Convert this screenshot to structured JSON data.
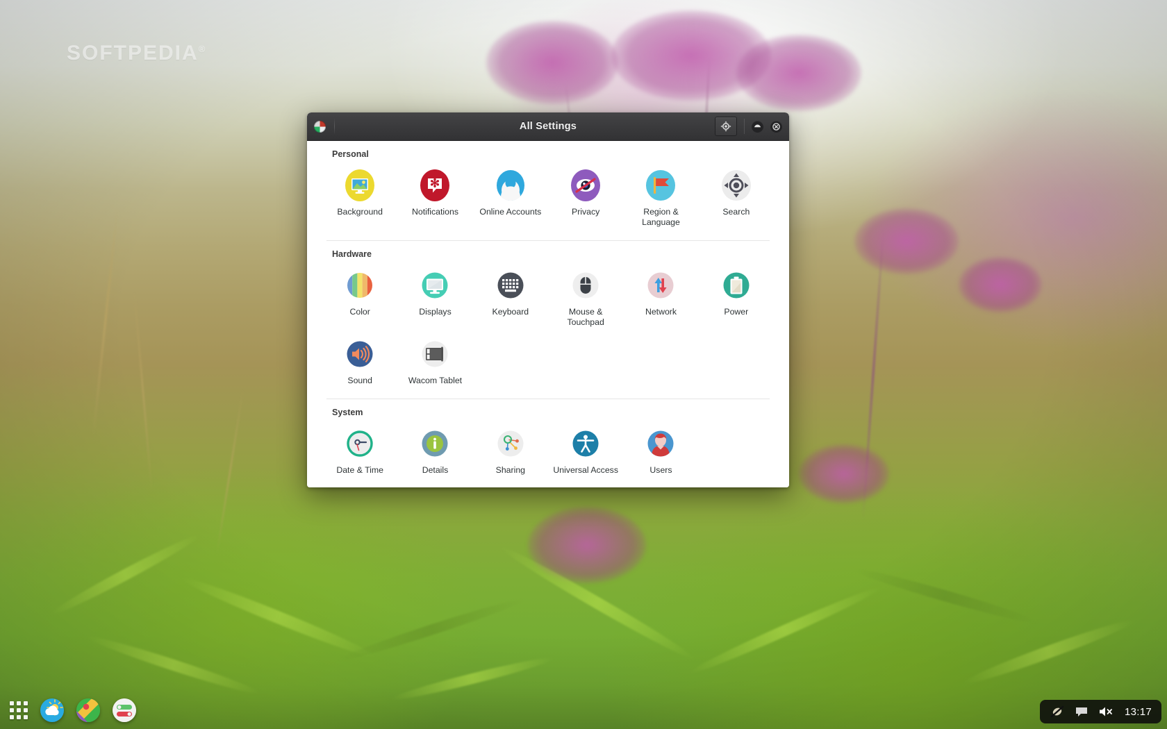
{
  "desktop": {
    "watermark": "SOFTPEDIA",
    "watermark_sup": "®"
  },
  "window": {
    "title": "All Settings",
    "appmenu_icon": "app-menu-icon",
    "search_button": "search-icon",
    "minimize_button": "minimize-icon",
    "close_button": "close-icon"
  },
  "sections": [
    {
      "title": "Personal",
      "items": [
        {
          "label": "Background",
          "icon": "background-icon"
        },
        {
          "label": "Notifications",
          "icon": "notifications-icon"
        },
        {
          "label": "Online Accounts",
          "icon": "online-accounts-icon"
        },
        {
          "label": "Privacy",
          "icon": "privacy-icon"
        },
        {
          "label": "Region & Language",
          "icon": "region-language-icon"
        },
        {
          "label": "Search",
          "icon": "search-settings-icon"
        }
      ]
    },
    {
      "title": "Hardware",
      "items": [
        {
          "label": "Color",
          "icon": "color-icon"
        },
        {
          "label": "Displays",
          "icon": "displays-icon"
        },
        {
          "label": "Keyboard",
          "icon": "keyboard-icon"
        },
        {
          "label": "Mouse & Touchpad",
          "icon": "mouse-touchpad-icon"
        },
        {
          "label": "Network",
          "icon": "network-icon"
        },
        {
          "label": "Power",
          "icon": "power-icon"
        },
        {
          "label": "Sound",
          "icon": "sound-icon"
        },
        {
          "label": "Wacom Tablet",
          "icon": "wacom-tablet-icon"
        }
      ]
    },
    {
      "title": "System",
      "items": [
        {
          "label": "Date & Time",
          "icon": "date-time-icon"
        },
        {
          "label": "Details",
          "icon": "details-icon"
        },
        {
          "label": "Sharing",
          "icon": "sharing-icon"
        },
        {
          "label": "Universal Access",
          "icon": "universal-access-icon"
        },
        {
          "label": "Users",
          "icon": "users-icon"
        }
      ]
    }
  ],
  "taskbar": {
    "apps_button": "apps-grid-icon",
    "launchers": [
      {
        "name": "weather-launcher-icon"
      },
      {
        "name": "maps-launcher-icon"
      },
      {
        "name": "permissions-launcher-icon"
      }
    ],
    "tray": {
      "network_icon": "network-disconnected-icon",
      "messages_icon": "messages-icon",
      "volume_icon": "volume-muted-icon",
      "clock": "13:17"
    }
  },
  "colors": {
    "titlebar": "#3b3b3d",
    "window_bg": "#ffffff",
    "label_text": "#2e3436",
    "section_text": "#3c3c3c",
    "divider": "#e6e6e6",
    "tray_bg": "#0c0c0c"
  }
}
